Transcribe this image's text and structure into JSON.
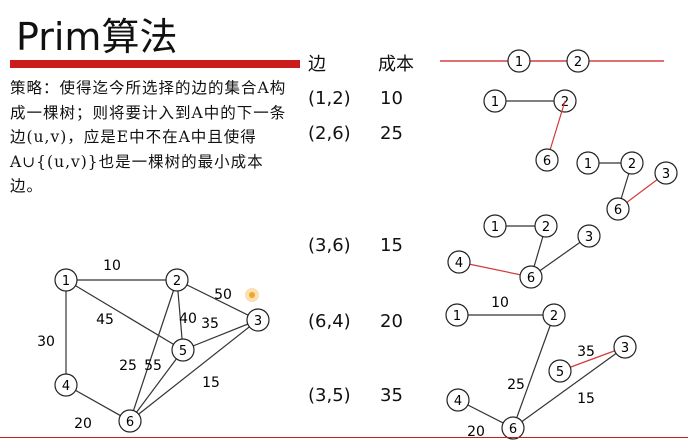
{
  "title": "Prim算法",
  "strategy": "策略：使得迄今所选择的边的集合A构成一棵树；则将要计入到A中的下一条边(u,v)，应是E中不在A中且使得A∪{(u,v)}也是一棵树的最小成本边。",
  "table": {
    "header_edge": "边",
    "header_cost": "成本",
    "rows": [
      {
        "edge": "(1,2)",
        "cost": "10"
      },
      {
        "edge": "(2,6)",
        "cost": "25"
      },
      {
        "edge": "(3,6)",
        "cost": "15"
      },
      {
        "edge": "(6,4)",
        "cost": "20"
      },
      {
        "edge": "(3,5)",
        "cost": "35"
      }
    ]
  },
  "graph": {
    "nodes": [
      "1",
      "2",
      "3",
      "4",
      "5",
      "6"
    ],
    "edges": [
      {
        "from": "1",
        "to": "2",
        "weight": "10"
      },
      {
        "from": "2",
        "to": "3",
        "weight": "50"
      },
      {
        "from": "1",
        "to": "5",
        "weight": "45"
      },
      {
        "from": "1",
        "to": "4",
        "weight": "30"
      },
      {
        "from": "2",
        "to": "5",
        "weight": "40"
      },
      {
        "from": "5",
        "to": "3",
        "weight": "35"
      },
      {
        "from": "2",
        "to": "6",
        "weight": "25"
      },
      {
        "from": "5",
        "to": "6",
        "weight": "55"
      },
      {
        "from": "6",
        "to": "3",
        "weight": "15"
      },
      {
        "from": "4",
        "to": "6",
        "weight": "20"
      }
    ]
  },
  "steps": [
    {
      "nodes": [
        "1",
        "2"
      ],
      "edges": [
        {
          "from": "1",
          "to": "2",
          "new": true
        }
      ],
      "labels": []
    },
    {
      "nodes": [
        "1",
        "2"
      ],
      "edges": [
        {
          "from": "1",
          "to": "2",
          "new": false
        }
      ],
      "labels": []
    },
    {
      "nodes": [
        "6"
      ],
      "edges": [
        {
          "from": "2",
          "to": "6",
          "new": true
        }
      ],
      "labels": []
    },
    {
      "nodes": [
        "1",
        "2",
        "6",
        "3"
      ],
      "edges": [
        {
          "from": "1",
          "to": "2",
          "new": false
        },
        {
          "from": "2",
          "to": "6",
          "new": false
        },
        {
          "from": "6",
          "to": "3",
          "new": true
        }
      ],
      "labels": []
    },
    {
      "nodes": [
        "1",
        "2",
        "3",
        "4",
        "6"
      ],
      "edges": [
        {
          "from": "1",
          "to": "2",
          "new": false
        },
        {
          "from": "2",
          "to": "6",
          "new": false
        },
        {
          "from": "6",
          "to": "3",
          "new": false
        },
        {
          "from": "4",
          "to": "6",
          "new": true
        }
      ],
      "labels": []
    },
    {
      "nodes": [
        "1",
        "2",
        "5",
        "3",
        "4",
        "6"
      ],
      "edges": [
        {
          "from": "1",
          "to": "2",
          "new": false
        },
        {
          "from": "5",
          "to": "3",
          "new": true
        },
        {
          "from": "2",
          "to": "6",
          "new": false
        },
        {
          "from": "6",
          "to": "3",
          "new": false
        },
        {
          "from": "4",
          "to": "6",
          "new": false
        }
      ],
      "labels": [
        "10",
        "35",
        "25",
        "15",
        "20"
      ]
    }
  ],
  "colors": {
    "accent": "#cc1b1b",
    "line": "#333333",
    "new_edge": "#d23a3a",
    "highlight": "#f2a623"
  }
}
